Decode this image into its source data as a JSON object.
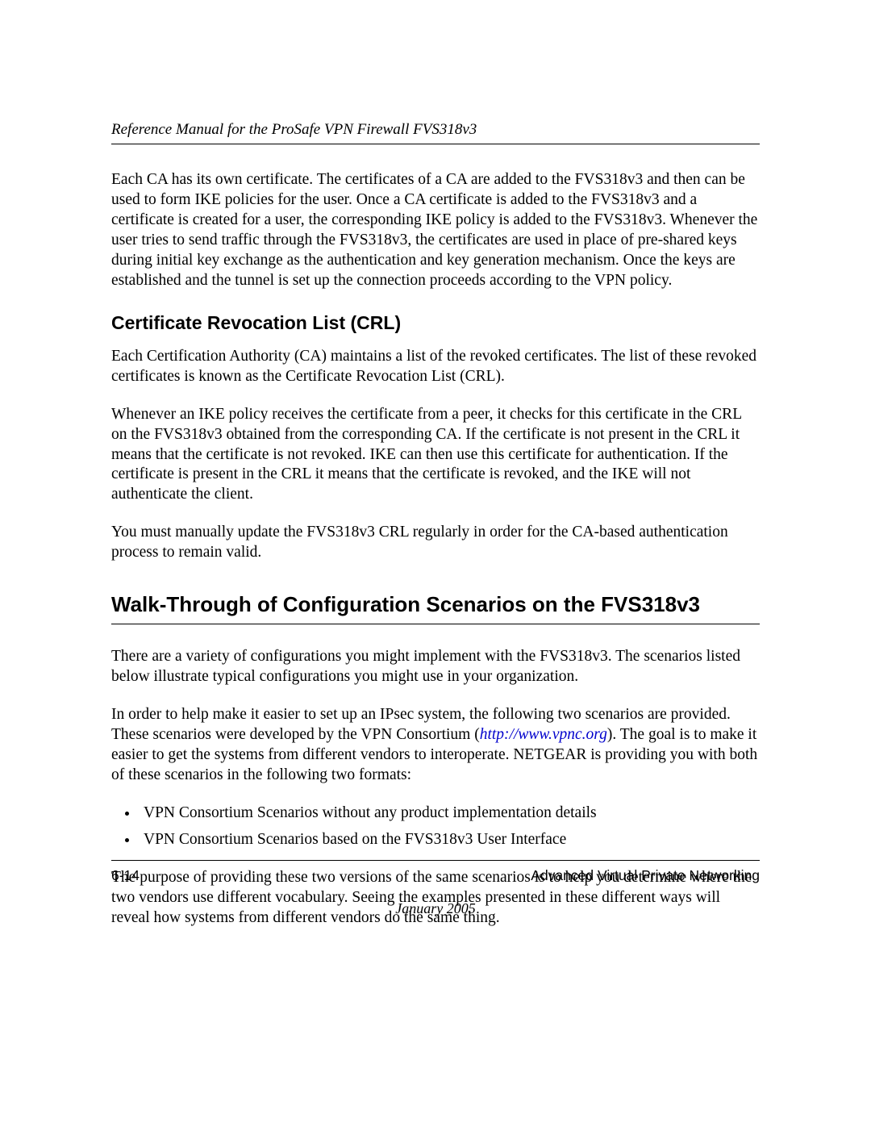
{
  "header": {
    "doc_title": "Reference Manual for the ProSafe VPN Firewall FVS318v3"
  },
  "intro": {
    "p1": "Each CA has its own certificate. The certificates of a CA are added to the FVS318v3 and then can be used to form IKE policies for the user. Once a CA certificate is added to the FVS318v3 and a certificate is created for a user, the corresponding IKE policy is added to the FVS318v3. Whenever the user tries to send traffic through the FVS318v3, the certificates are used in place of pre-shared keys during initial key exchange as the authentication and key generation mechanism. Once the keys are established and the tunnel is set up the connection proceeds according to the VPN policy."
  },
  "section_crl": {
    "heading": "Certificate Revocation List (CRL)",
    "p1": "Each Certification Authority (CA) maintains a list of the revoked certificates. The list of these revoked certificates is known as the Certificate Revocation List (CRL).",
    "p2": "Whenever an IKE policy receives the certificate from a peer, it checks for this certificate in the CRL on the FVS318v3 obtained from the corresponding CA. If the certificate is not present in the CRL it means that the certificate is not revoked. IKE can then use this certificate for authentication. If the certificate is present in the CRL it means that the certificate is revoked, and the IKE will not authenticate the client.",
    "p3": "You must manually update the FVS318v3 CRL regularly in order for the CA-based authentication process to remain valid."
  },
  "section_walk": {
    "heading": "Walk-Through of Configuration Scenarios on the FVS318v3",
    "p1": "There are a variety of configurations you might implement with the FVS318v3. The scenarios listed below illustrate typical configurations you might use in your organization.",
    "p2_pre": "In order to help make it easier to set up an IPsec system, the following two scenarios are provided. These scenarios were developed by the VPN Consortium (",
    "link_text": "http://www.vpnc.org",
    "p2_post": "). The goal is to make it easier to get the systems from different vendors to interoperate. NETGEAR is providing you with both of these scenarios in the following two formats:",
    "bullets": [
      "VPN Consortium Scenarios without any product implementation details",
      "VPN Consortium Scenarios based on the FVS318v3 User Interface"
    ],
    "p3": "The purpose of providing these two versions of the same scenarios is to help you determine where the two vendors use different vocabulary. Seeing the examples presented in these different ways will reveal how systems from different vendors do the same thing."
  },
  "footer": {
    "page_number": "6-14",
    "chapter": "Advanced Virtual Private Networking",
    "date": "January 2005"
  }
}
